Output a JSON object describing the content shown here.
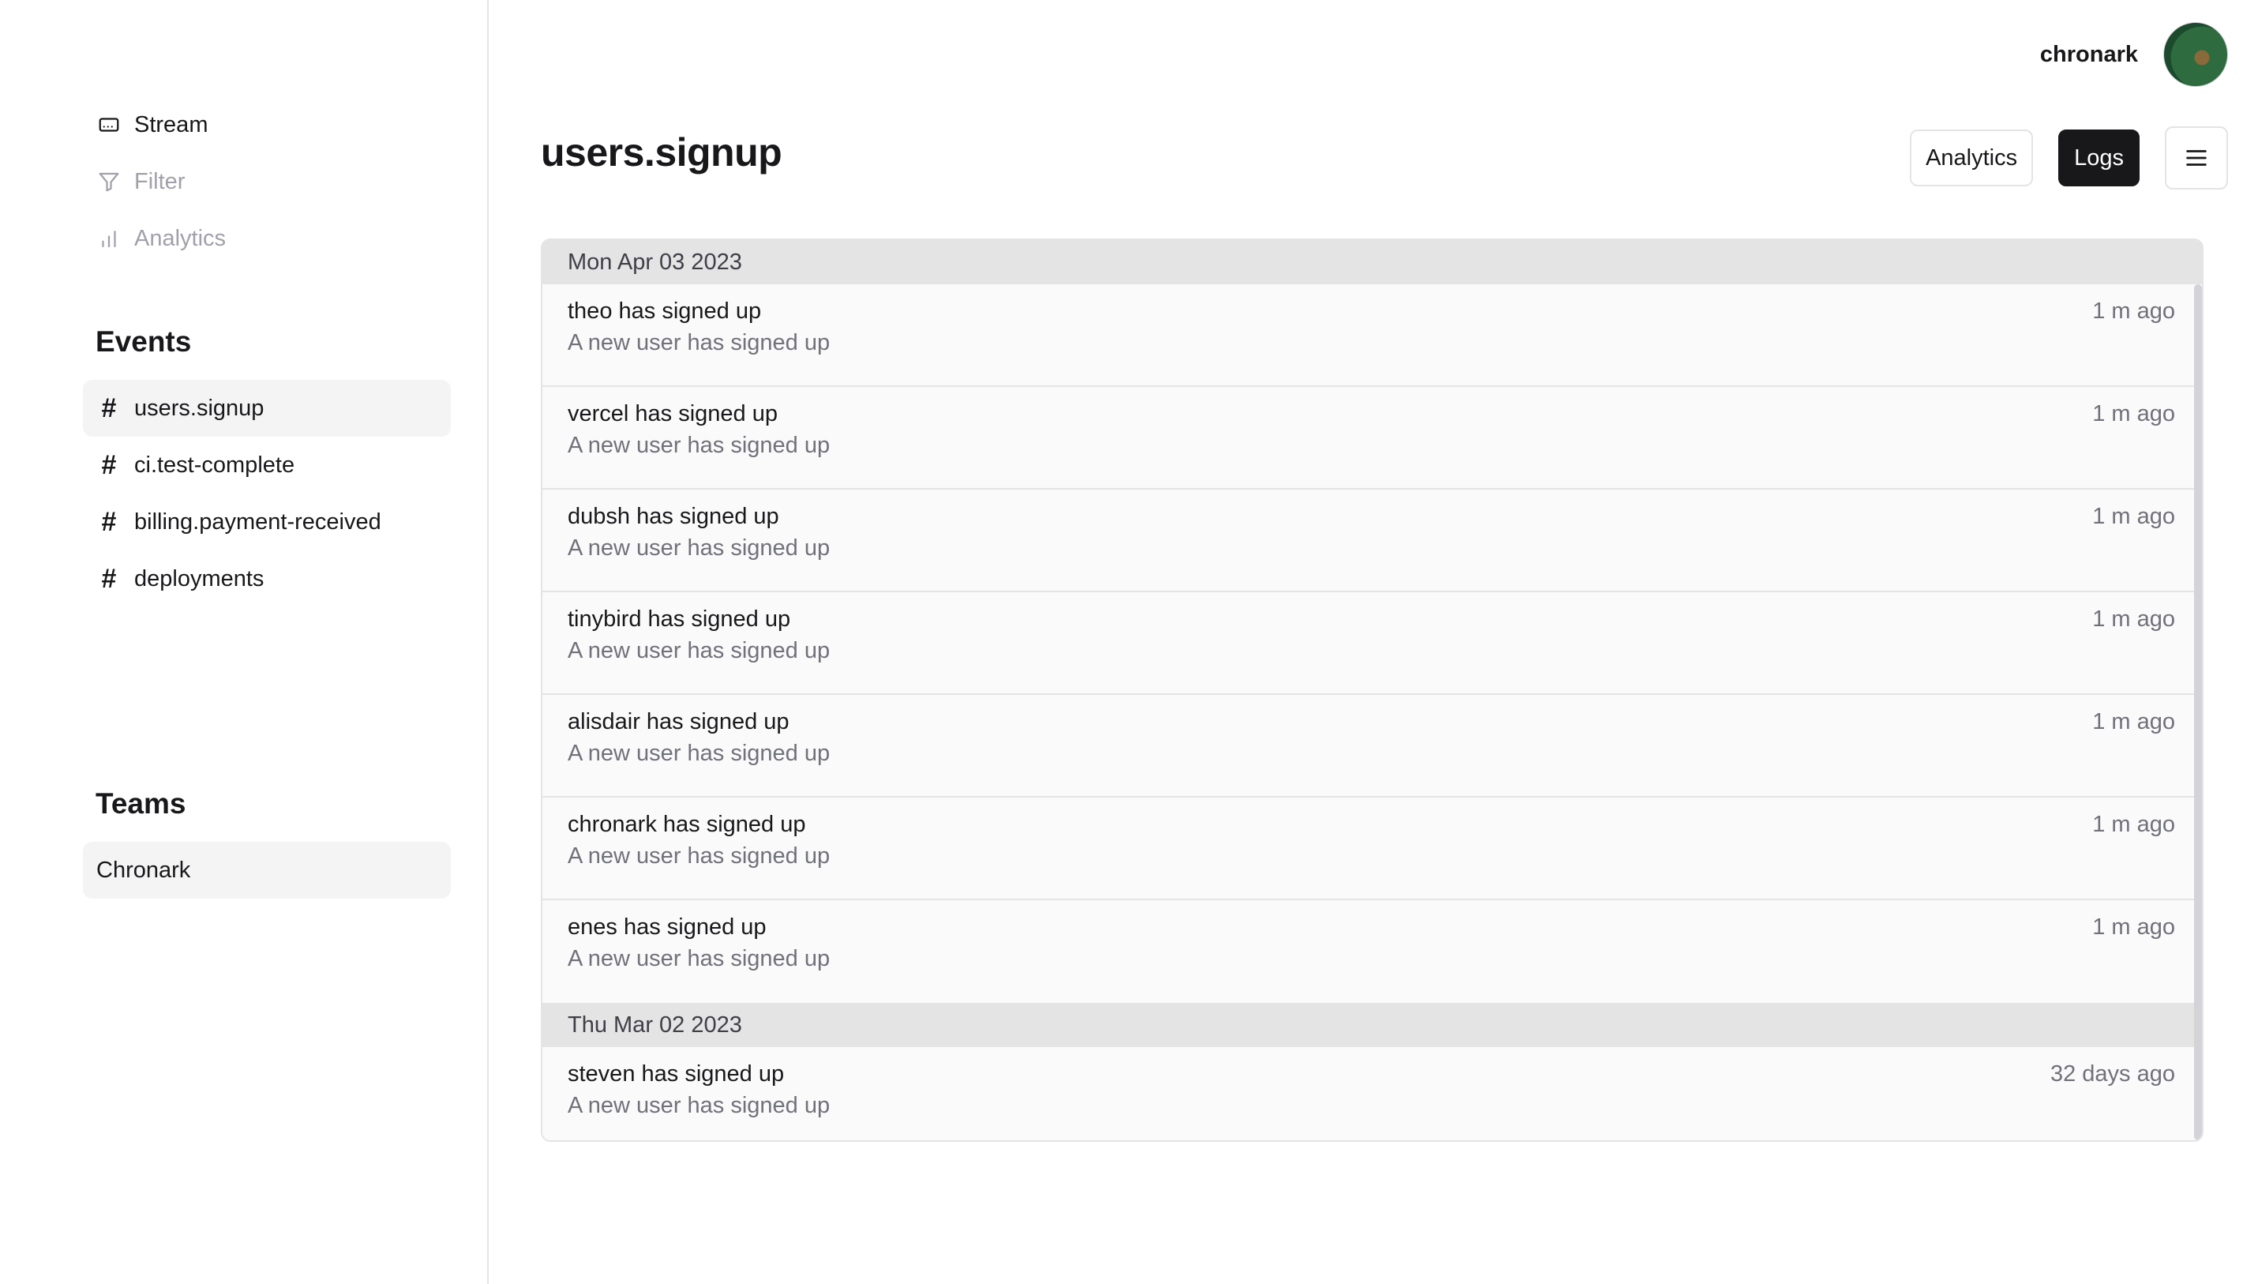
{
  "sidebar": {
    "nav": [
      {
        "label": "Stream",
        "icon": "stream-icon"
      },
      {
        "label": "Filter",
        "icon": "filter-icon"
      },
      {
        "label": "Analytics",
        "icon": "bar-chart-icon"
      }
    ],
    "events_title": "Events",
    "events": [
      {
        "label": "users.signup",
        "active": true
      },
      {
        "label": "ci.test-complete",
        "active": false
      },
      {
        "label": "billing.payment-received",
        "active": false
      },
      {
        "label": "deployments",
        "active": false
      }
    ],
    "teams_title": "Teams",
    "teams": [
      {
        "label": "Chronark"
      }
    ]
  },
  "header": {
    "user_name": "chronark",
    "title": "users.signup",
    "analytics_label": "Analytics",
    "logs_label": "Logs",
    "menu_icon": "hamburger-menu-icon"
  },
  "log": {
    "groups": [
      {
        "date": "Mon Apr 03 2023",
        "rows": [
          {
            "title": "theo has signed up",
            "desc": "A new user has signed up",
            "time": "1 m ago"
          },
          {
            "title": "vercel has signed up",
            "desc": "A new user has signed up",
            "time": "1 m ago"
          },
          {
            "title": "dubsh has signed up",
            "desc": "A new user has signed up",
            "time": "1 m ago"
          },
          {
            "title": "tinybird has signed up",
            "desc": "A new user has signed up",
            "time": "1 m ago"
          },
          {
            "title": "alisdair has signed up",
            "desc": "A new user has signed up",
            "time": "1 m ago"
          },
          {
            "title": "chronark has signed up",
            "desc": "A new user has signed up",
            "time": "1 m ago"
          },
          {
            "title": "enes has signed up",
            "desc": "A new user has signed up",
            "time": "1 m ago"
          }
        ]
      },
      {
        "date": "Thu Mar 02 2023",
        "rows": [
          {
            "title": "steven has signed up",
            "desc": "A new user has signed up",
            "time": "32 days ago"
          }
        ]
      }
    ]
  }
}
